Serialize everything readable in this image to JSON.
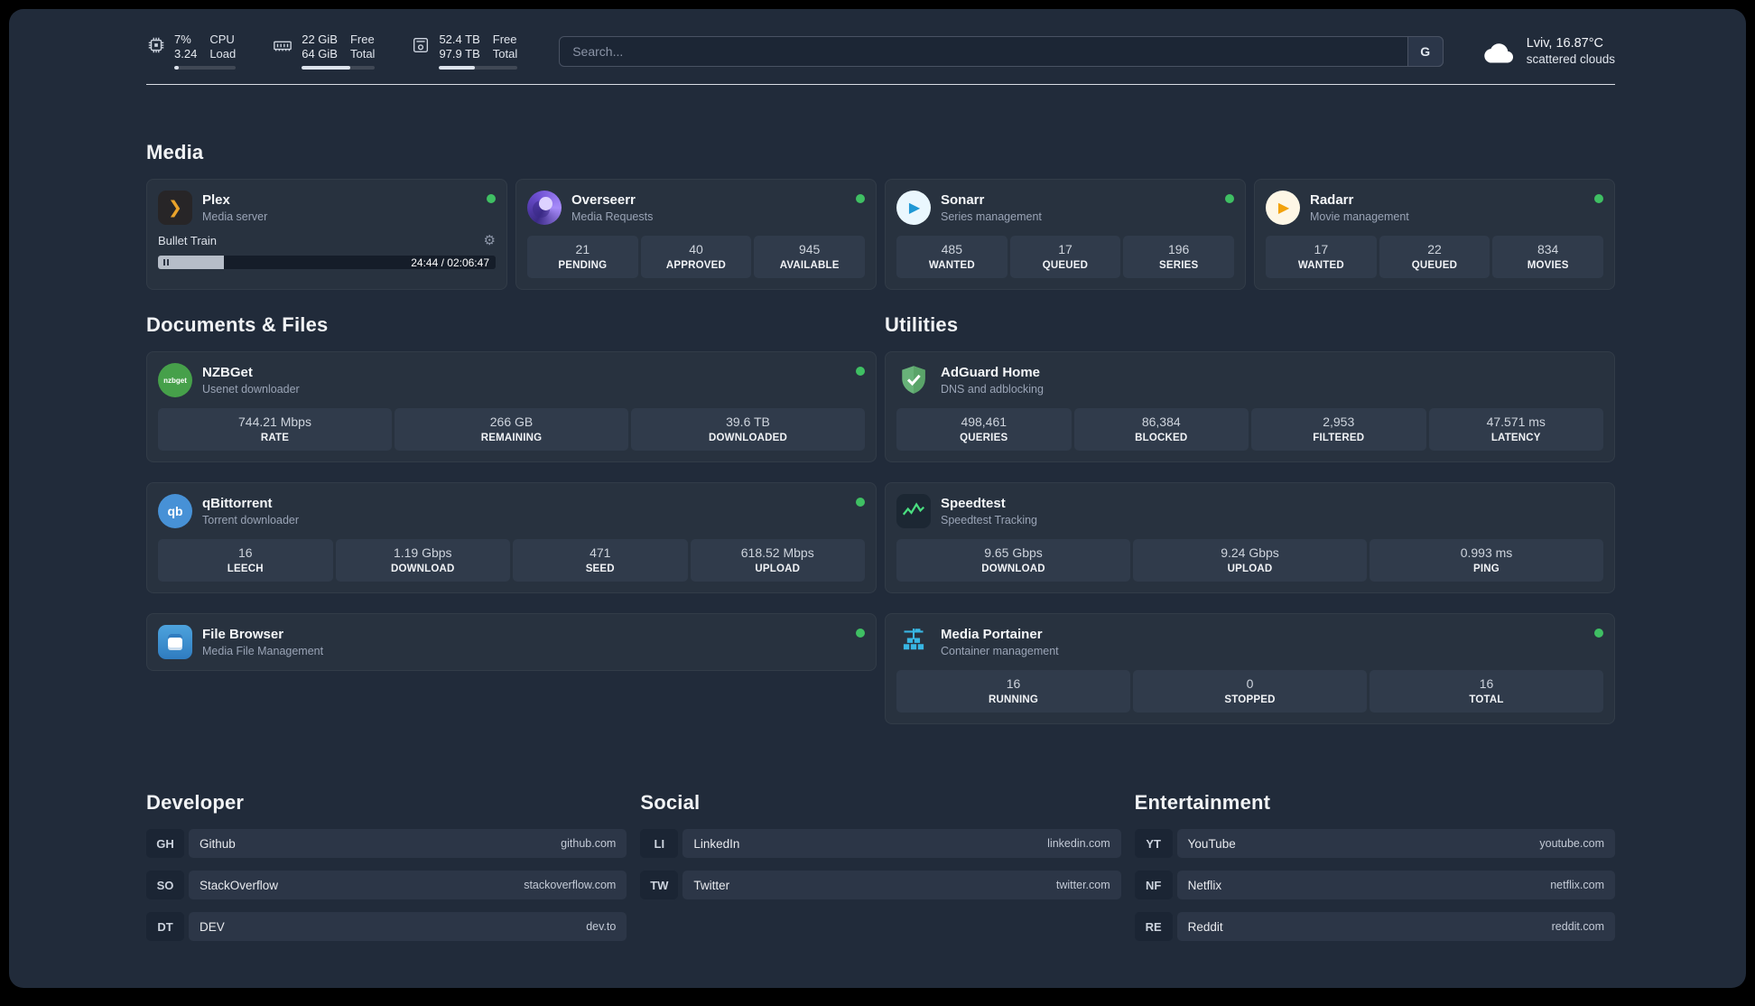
{
  "colors": {
    "status_online": "#3fbf63",
    "page_background": "#212b3a",
    "card_background": "#28323f"
  },
  "glyphs": {
    "plex": "❯",
    "gear": "⚙",
    "play": "▶",
    "qbittorrent": "qb",
    "nzbget": "nzbget"
  },
  "topbar": {
    "cpu": {
      "value_top": "7%",
      "value_bottom": "3.24",
      "label_top": "CPU",
      "label_bottom": "Load",
      "bar_percent": 7
    },
    "memory": {
      "value_top": "22 GiB",
      "value_bottom": "64 GiB",
      "label_top": "Free",
      "label_bottom": "Total",
      "bar_percent": 66
    },
    "disk": {
      "value_top": "52.4 TB",
      "value_bottom": "97.9 TB",
      "label_top": "Free",
      "label_bottom": "Total",
      "bar_percent": 46
    },
    "search": {
      "placeholder": "Search...",
      "engine_button": "G"
    },
    "weather": {
      "location": "Lviv, 16.87°C",
      "condition": "scattered clouds"
    }
  },
  "media": {
    "title": "Media",
    "plex": {
      "name": "Plex",
      "subtitle": "Media server",
      "now_playing": "Bullet Train",
      "time": "24:44 / 02:06:47",
      "progress_percent": 19.5
    },
    "overseerr": {
      "name": "Overseerr",
      "subtitle": "Media Requests",
      "stats": [
        {
          "value": "21",
          "label": "PENDING"
        },
        {
          "value": "40",
          "label": "APPROVED"
        },
        {
          "value": "945",
          "label": "AVAILABLE"
        }
      ]
    },
    "sonarr": {
      "name": "Sonarr",
      "subtitle": "Series management",
      "stats": [
        {
          "value": "485",
          "label": "WANTED"
        },
        {
          "value": "17",
          "label": "QUEUED"
        },
        {
          "value": "196",
          "label": "SERIES"
        }
      ]
    },
    "radarr": {
      "name": "Radarr",
      "subtitle": "Movie management",
      "stats": [
        {
          "value": "17",
          "label": "WANTED"
        },
        {
          "value": "22",
          "label": "QUEUED"
        },
        {
          "value": "834",
          "label": "MOVIES"
        }
      ]
    }
  },
  "documents": {
    "title": "Documents & Files",
    "nzbget": {
      "name": "NZBGet",
      "subtitle": "Usenet downloader",
      "stats": [
        {
          "value": "744.21 Mbps",
          "label": "RATE"
        },
        {
          "value": "266 GB",
          "label": "REMAINING"
        },
        {
          "value": "39.6 TB",
          "label": "DOWNLOADED"
        }
      ]
    },
    "qbittorrent": {
      "name": "qBittorrent",
      "subtitle": "Torrent downloader",
      "stats": [
        {
          "value": "16",
          "label": "LEECH"
        },
        {
          "value": "1.19 Gbps",
          "label": "DOWNLOAD"
        },
        {
          "value": "471",
          "label": "SEED"
        },
        {
          "value": "618.52 Mbps",
          "label": "UPLOAD"
        }
      ]
    },
    "filebrowser": {
      "name": "File Browser",
      "subtitle": "Media File Management"
    }
  },
  "utilities": {
    "title": "Utilities",
    "adguard": {
      "name": "AdGuard Home",
      "subtitle": "DNS and adblocking",
      "stats": [
        {
          "value": "498,461",
          "label": "QUERIES"
        },
        {
          "value": "86,384",
          "label": "BLOCKED"
        },
        {
          "value": "2,953",
          "label": "FILTERED"
        },
        {
          "value": "47.571 ms",
          "label": "LATENCY"
        }
      ]
    },
    "speedtest": {
      "name": "Speedtest",
      "subtitle": "Speedtest Tracking",
      "stats": [
        {
          "value": "9.65 Gbps",
          "label": "DOWNLOAD"
        },
        {
          "value": "9.24 Gbps",
          "label": "UPLOAD"
        },
        {
          "value": "0.993 ms",
          "label": "PING"
        }
      ]
    },
    "portainer": {
      "name": "Media Portainer",
      "subtitle": "Container management",
      "stats": [
        {
          "value": "16",
          "label": "RUNNING"
        },
        {
          "value": "0",
          "label": "STOPPED"
        },
        {
          "value": "16",
          "label": "TOTAL"
        }
      ]
    }
  },
  "bookmarks": {
    "developer": {
      "title": "Developer",
      "items": [
        {
          "abbr": "GH",
          "name": "Github",
          "url": "github.com"
        },
        {
          "abbr": "SO",
          "name": "StackOverflow",
          "url": "stackoverflow.com"
        },
        {
          "abbr": "DT",
          "name": "DEV",
          "url": "dev.to"
        }
      ]
    },
    "social": {
      "title": "Social",
      "items": [
        {
          "abbr": "LI",
          "name": "LinkedIn",
          "url": "linkedin.com"
        },
        {
          "abbr": "TW",
          "name": "Twitter",
          "url": "twitter.com"
        }
      ]
    },
    "entertainment": {
      "title": "Entertainment",
      "items": [
        {
          "abbr": "YT",
          "name": "YouTube",
          "url": "youtube.com"
        },
        {
          "abbr": "NF",
          "name": "Netflix",
          "url": "netflix.com"
        },
        {
          "abbr": "RE",
          "name": "Reddit",
          "url": "reddit.com"
        }
      ]
    }
  }
}
